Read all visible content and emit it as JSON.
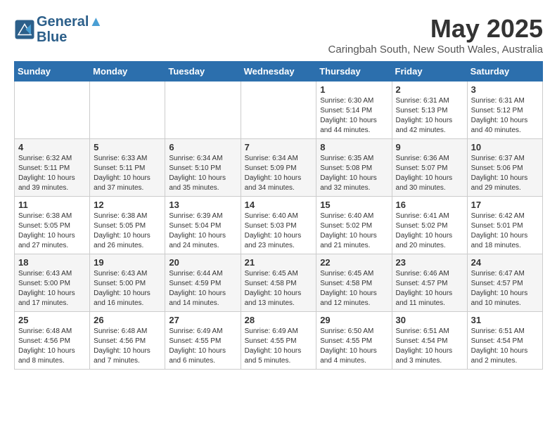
{
  "logo": {
    "line1": "General",
    "line2": "Blue"
  },
  "title": "May 2025",
  "subtitle": "Caringbah South, New South Wales, Australia",
  "days_of_week": [
    "Sunday",
    "Monday",
    "Tuesday",
    "Wednesday",
    "Thursday",
    "Friday",
    "Saturday"
  ],
  "weeks": [
    [
      {
        "day": "",
        "info": ""
      },
      {
        "day": "",
        "info": ""
      },
      {
        "day": "",
        "info": ""
      },
      {
        "day": "",
        "info": ""
      },
      {
        "day": "1",
        "info": "Sunrise: 6:30 AM\nSunset: 5:14 PM\nDaylight: 10 hours\nand 44 minutes."
      },
      {
        "day": "2",
        "info": "Sunrise: 6:31 AM\nSunset: 5:13 PM\nDaylight: 10 hours\nand 42 minutes."
      },
      {
        "day": "3",
        "info": "Sunrise: 6:31 AM\nSunset: 5:12 PM\nDaylight: 10 hours\nand 40 minutes."
      }
    ],
    [
      {
        "day": "4",
        "info": "Sunrise: 6:32 AM\nSunset: 5:11 PM\nDaylight: 10 hours\nand 39 minutes."
      },
      {
        "day": "5",
        "info": "Sunrise: 6:33 AM\nSunset: 5:11 PM\nDaylight: 10 hours\nand 37 minutes."
      },
      {
        "day": "6",
        "info": "Sunrise: 6:34 AM\nSunset: 5:10 PM\nDaylight: 10 hours\nand 35 minutes."
      },
      {
        "day": "7",
        "info": "Sunrise: 6:34 AM\nSunset: 5:09 PM\nDaylight: 10 hours\nand 34 minutes."
      },
      {
        "day": "8",
        "info": "Sunrise: 6:35 AM\nSunset: 5:08 PM\nDaylight: 10 hours\nand 32 minutes."
      },
      {
        "day": "9",
        "info": "Sunrise: 6:36 AM\nSunset: 5:07 PM\nDaylight: 10 hours\nand 30 minutes."
      },
      {
        "day": "10",
        "info": "Sunrise: 6:37 AM\nSunset: 5:06 PM\nDaylight: 10 hours\nand 29 minutes."
      }
    ],
    [
      {
        "day": "11",
        "info": "Sunrise: 6:38 AM\nSunset: 5:05 PM\nDaylight: 10 hours\nand 27 minutes."
      },
      {
        "day": "12",
        "info": "Sunrise: 6:38 AM\nSunset: 5:05 PM\nDaylight: 10 hours\nand 26 minutes."
      },
      {
        "day": "13",
        "info": "Sunrise: 6:39 AM\nSunset: 5:04 PM\nDaylight: 10 hours\nand 24 minutes."
      },
      {
        "day": "14",
        "info": "Sunrise: 6:40 AM\nSunset: 5:03 PM\nDaylight: 10 hours\nand 23 minutes."
      },
      {
        "day": "15",
        "info": "Sunrise: 6:40 AM\nSunset: 5:02 PM\nDaylight: 10 hours\nand 21 minutes."
      },
      {
        "day": "16",
        "info": "Sunrise: 6:41 AM\nSunset: 5:02 PM\nDaylight: 10 hours\nand 20 minutes."
      },
      {
        "day": "17",
        "info": "Sunrise: 6:42 AM\nSunset: 5:01 PM\nDaylight: 10 hours\nand 18 minutes."
      }
    ],
    [
      {
        "day": "18",
        "info": "Sunrise: 6:43 AM\nSunset: 5:00 PM\nDaylight: 10 hours\nand 17 minutes."
      },
      {
        "day": "19",
        "info": "Sunrise: 6:43 AM\nSunset: 5:00 PM\nDaylight: 10 hours\nand 16 minutes."
      },
      {
        "day": "20",
        "info": "Sunrise: 6:44 AM\nSunset: 4:59 PM\nDaylight: 10 hours\nand 14 minutes."
      },
      {
        "day": "21",
        "info": "Sunrise: 6:45 AM\nSunset: 4:58 PM\nDaylight: 10 hours\nand 13 minutes."
      },
      {
        "day": "22",
        "info": "Sunrise: 6:45 AM\nSunset: 4:58 PM\nDaylight: 10 hours\nand 12 minutes."
      },
      {
        "day": "23",
        "info": "Sunrise: 6:46 AM\nSunset: 4:57 PM\nDaylight: 10 hours\nand 11 minutes."
      },
      {
        "day": "24",
        "info": "Sunrise: 6:47 AM\nSunset: 4:57 PM\nDaylight: 10 hours\nand 10 minutes."
      }
    ],
    [
      {
        "day": "25",
        "info": "Sunrise: 6:48 AM\nSunset: 4:56 PM\nDaylight: 10 hours\nand 8 minutes."
      },
      {
        "day": "26",
        "info": "Sunrise: 6:48 AM\nSunset: 4:56 PM\nDaylight: 10 hours\nand 7 minutes."
      },
      {
        "day": "27",
        "info": "Sunrise: 6:49 AM\nSunset: 4:55 PM\nDaylight: 10 hours\nand 6 minutes."
      },
      {
        "day": "28",
        "info": "Sunrise: 6:49 AM\nSunset: 4:55 PM\nDaylight: 10 hours\nand 5 minutes."
      },
      {
        "day": "29",
        "info": "Sunrise: 6:50 AM\nSunset: 4:55 PM\nDaylight: 10 hours\nand 4 minutes."
      },
      {
        "day": "30",
        "info": "Sunrise: 6:51 AM\nSunset: 4:54 PM\nDaylight: 10 hours\nand 3 minutes."
      },
      {
        "day": "31",
        "info": "Sunrise: 6:51 AM\nSunset: 4:54 PM\nDaylight: 10 hours\nand 2 minutes."
      }
    ]
  ]
}
